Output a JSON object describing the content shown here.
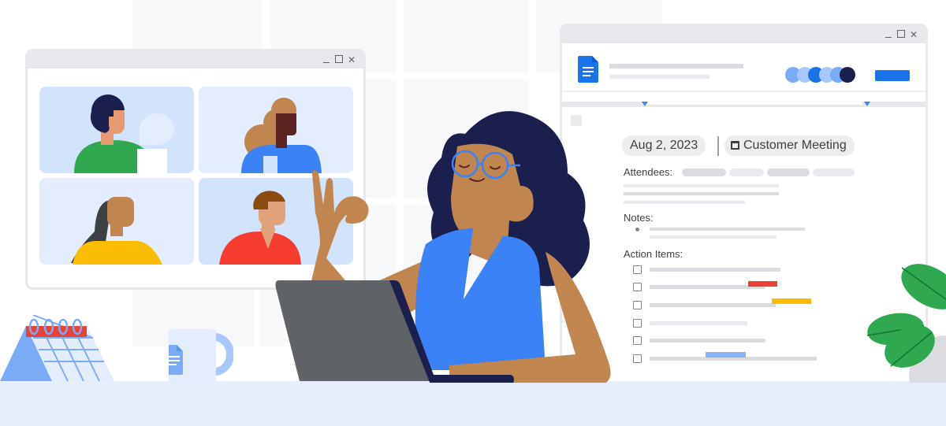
{
  "scene": "Illustration: remote meeting with video call window and meeting notes document",
  "colors": {
    "brand_blue": "#1a73e8",
    "google_red": "#ea4335",
    "google_yellow": "#fbbc04",
    "google_green": "#34a853",
    "desk": "#e6edfb",
    "navy": "#1a1f4e"
  },
  "video_window": {
    "controls": [
      "minimize",
      "maximize",
      "close"
    ],
    "close_glyph": "✕",
    "participants": [
      {
        "shirt": "green",
        "extra": "speech-bubble"
      },
      {
        "shirt": "blue"
      },
      {
        "shirt": "yellow"
      },
      {
        "shirt": "red"
      }
    ]
  },
  "doc_window": {
    "controls": [
      "minimize",
      "maximize",
      "close"
    ],
    "close_glyph": "✕",
    "icon": "google-docs-icon",
    "collaborator_avatar_count": 6,
    "share_button": "",
    "date_chip": "Aug 2, 2023",
    "event_chip": "Customer Meeting",
    "event_icon": "calendar-event-icon",
    "attendees_label": "Attendees:",
    "notes_label": "Notes:",
    "action_items_label": "Action Items:",
    "action_items": [
      {
        "checked": false,
        "tag": null
      },
      {
        "checked": false,
        "tag": "red"
      },
      {
        "checked": false,
        "tag": "yellow"
      },
      {
        "checked": false,
        "tag": null
      },
      {
        "checked": false,
        "tag": null
      },
      {
        "checked": false,
        "tag": "blue"
      }
    ]
  },
  "desk_items": [
    "calendar",
    "docs-mug",
    "laptop",
    "plant"
  ]
}
